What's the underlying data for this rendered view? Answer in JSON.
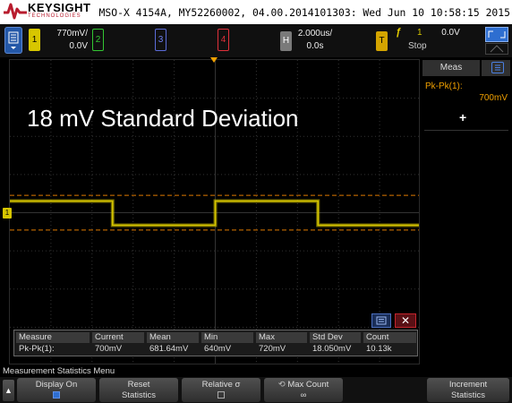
{
  "header": {
    "brand": "KEYSIGHT",
    "brand_sub": "TECHNOLOGIES",
    "model_line": "MSO-X 4154A, MY52260002, 04.00.2014101303: Wed Jun 10 10:58:15 2015"
  },
  "channels": {
    "ch1": {
      "label": "1",
      "scale": "770mV/",
      "offset": "0.0V"
    },
    "ch2": {
      "label": "2"
    },
    "ch3": {
      "label": "3"
    },
    "ch4": {
      "label": "4"
    }
  },
  "horizontal": {
    "label": "H",
    "scale": "2.000us/",
    "delay": "0.0s"
  },
  "trigger": {
    "label": "T",
    "symbol": "ƒ",
    "source": "1",
    "status": "Stop",
    "level": "0.0V"
  },
  "ground_marker": "1",
  "annotation": "18 mV Standard Deviation",
  "sidebar": {
    "tab_label": "Meas",
    "measurement_name": "Pk-Pk(1):",
    "measurement_value": "700mV",
    "add_label": "+"
  },
  "stats": {
    "headers": [
      "Measure",
      "Current",
      "Mean",
      "Min",
      "Max",
      "Std Dev",
      "Count"
    ],
    "row": [
      "Pk-Pk(1):",
      "700mV",
      "681.64mV",
      "640mV",
      "720mV",
      "18.050mV",
      "10.13k"
    ]
  },
  "menu_title": "Measurement Statistics Menu",
  "softkeys": {
    "display_on": "Display On",
    "reset_line1": "Reset",
    "reset_line2": "Statistics",
    "relative": "Relative σ",
    "max_count_line1": "Max Count",
    "max_count_line2": "∞",
    "increment_line1": "Increment",
    "increment_line2": "Statistics"
  },
  "colors": {
    "ch1": "#d7c600",
    "ch2": "#33c633",
    "ch3": "#5b6cd9",
    "ch4": "#e0303a",
    "trigger": "#f0a000",
    "marker": "#e07a00",
    "accent": "#2e6ed0"
  },
  "icons": {
    "logo": "keysight-wave-logo",
    "menu": "menu-icon",
    "table": "table-icon",
    "close": "close-icon",
    "up": "up-arrow-icon",
    "max_count": "knob-icon"
  },
  "waveform": {
    "type": "square",
    "segments": [
      {
        "t_div": 0.0,
        "level": "high"
      },
      {
        "t_div": 2.5,
        "level": "low"
      },
      {
        "t_div": 5.0,
        "level": "high"
      },
      {
        "t_div": 7.5,
        "level": "low"
      },
      {
        "t_div": 10.0,
        "level": "end"
      }
    ],
    "volts_per_div": 0.77,
    "cursor_levels_v": [
      0.35,
      -0.35
    ]
  }
}
